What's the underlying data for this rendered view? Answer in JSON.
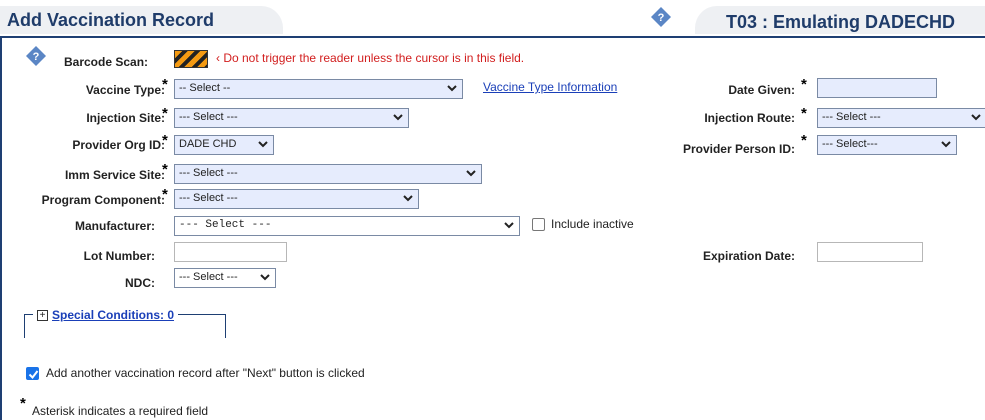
{
  "header": {
    "title": "Add Vaccination Record",
    "environment": "T03 : Emulating DADECHD"
  },
  "form": {
    "barcode": {
      "label": "Barcode Scan:",
      "warning": "‹ Do not trigger the reader unless the cursor is in this field."
    },
    "vaccine_type": {
      "label": "Vaccine Type:",
      "value": "-- Select --",
      "info_link": "Vaccine Type Information"
    },
    "date_given": {
      "label": "Date Given:",
      "value": ""
    },
    "injection_site": {
      "label": "Injection Site:",
      "value": "--- Select ---"
    },
    "injection_route": {
      "label": "Injection Route:",
      "value": "--- Select ---"
    },
    "provider_org_id": {
      "label": "Provider Org ID:",
      "value": "DADE CHD"
    },
    "provider_person_id": {
      "label": "Provider Person ID:",
      "value": "--- Select---"
    },
    "imm_service_site": {
      "label": "Imm Service Site:",
      "value": "--- Select ---"
    },
    "program_component": {
      "label": "Program Component:",
      "value": "--- Select ---"
    },
    "manufacturer": {
      "label": "Manufacturer:",
      "value": "--- Select ---",
      "include_inactive_label": "Include inactive",
      "include_inactive_checked": false
    },
    "lot_number": {
      "label": "Lot Number:",
      "value": ""
    },
    "expiration_date": {
      "label": "Expiration Date:",
      "value": ""
    },
    "ndc": {
      "label": "NDC:",
      "value": "--- Select ---"
    },
    "required_marker": "*"
  },
  "special_conditions": {
    "label": "Special Conditions: 0"
  },
  "add_another": {
    "label": "Add another vaccination record after \"Next\" button is clicked",
    "checked": true
  },
  "footer": {
    "asterisk": "*",
    "note": "Asterisk indicates a required field"
  },
  "colors": {
    "heading": "#1f3c6a",
    "warning": "#d21e1e",
    "link": "#1a3fb8",
    "required_bg": "#e6ecfd"
  }
}
